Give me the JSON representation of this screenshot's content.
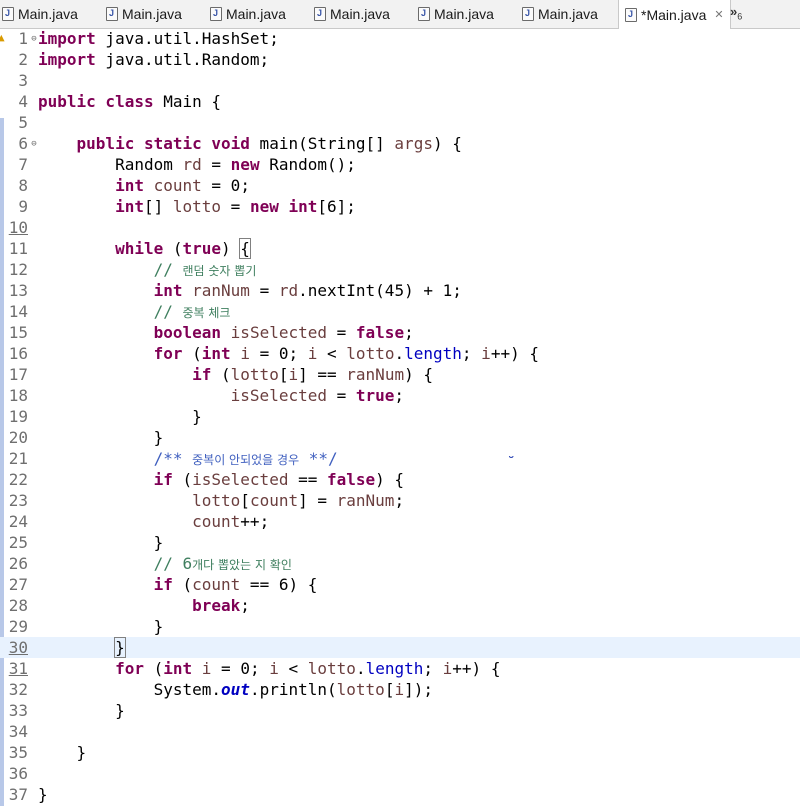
{
  "tabs": [
    {
      "label": "Main.java",
      "active": false
    },
    {
      "label": "Main.java",
      "active": false
    },
    {
      "label": "Main.java",
      "active": false
    },
    {
      "label": "Main.java",
      "active": false
    },
    {
      "label": "Main.java",
      "active": false
    },
    {
      "label": "Main.java",
      "active": false
    },
    {
      "label": "*Main.java",
      "active": true,
      "close": "✕"
    }
  ],
  "overflow": {
    "symbol": "»",
    "count": "6"
  },
  "lines": [
    "1",
    "2",
    "3",
    "4",
    "5",
    "6",
    "7",
    "8",
    "9",
    "10",
    "11",
    "12",
    "13",
    "14",
    "15",
    "16",
    "17",
    "18",
    "19",
    "20",
    "21",
    "22",
    "23",
    "24",
    "25",
    "26",
    "27",
    "28",
    "29",
    "30",
    "31",
    "32",
    "33",
    "34",
    "35",
    "36",
    "37"
  ],
  "code": {
    "l1_kw": "import",
    "l1_rest": " java.util.HashSet;",
    "l2_kw": "import",
    "l2_rest": " java.util.Random;",
    "l4_kw": "public class",
    "l4_rest": " Main {",
    "l6_kw": "public static void",
    "l6_a": " main(String[] ",
    "l6_var": "args",
    "l6_b": ") {",
    "l7_a": "Random ",
    "l7_var": "rd",
    "l7_b": " = ",
    "l7_kw": "new",
    "l7_c": " Random();",
    "l8_kw": "int",
    "l8_sp": " ",
    "l8_var": "count",
    "l8_b": " = 0;",
    "l9_kw": "int",
    "l9_a": "[] ",
    "l9_var": "lotto",
    "l9_b": " = ",
    "l9_kw2": "new",
    "l9_sp": " ",
    "l9_kw3": "int",
    "l9_c": "[6];",
    "l11_kw": "while",
    "l11_a": " (",
    "l11_kw2": "true",
    "l11_b": ") ",
    "l11_brace": "{",
    "l12_cmt": "// ",
    "l12_ko": "랜덤 숫자 뽑기",
    "l13_kw": "int",
    "l13_sp": " ",
    "l13_var": "ranNum",
    "l13_a": " = ",
    "l13_var2": "rd",
    "l13_b": ".nextInt(45) + 1;",
    "l14_cmt": "// ",
    "l14_ko": "중복 체크",
    "l15_kw": "boolean",
    "l15_sp": " ",
    "l15_var": "isSelected",
    "l15_a": " = ",
    "l15_kw2": "false",
    "l15_b": ";",
    "l16_kw": "for",
    "l16_a": " (",
    "l16_kw2": "int",
    "l16_sp": " ",
    "l16_var": "i",
    "l16_b": " = 0; ",
    "l16_var2": "i",
    "l16_c": " < ",
    "l16_var3": "lotto",
    "l16_d": ".",
    "l16_fld": "length",
    "l16_e": "; ",
    "l16_var4": "i",
    "l16_f": "++) {",
    "l17_kw": "if",
    "l17_a": " (",
    "l17_var": "lotto",
    "l17_b": "[",
    "l17_var2": "i",
    "l17_c": "] == ",
    "l17_var3": "ranNum",
    "l17_d": ") {",
    "l18_var": "isSelected",
    "l18_a": " = ",
    "l18_kw": "true",
    "l18_b": ";",
    "l19": "}",
    "l20": "}",
    "l21_jdoc": "/** ",
    "l21_ko": "중복이 안되었을 경우",
    "l21_end": " **/",
    "l22_kw": "if",
    "l22_a": " (",
    "l22_var": "isSelected",
    "l22_b": " == ",
    "l22_kw2": "false",
    "l22_c": ") {",
    "l23_var": "lotto",
    "l23_a": "[",
    "l23_var2": "count",
    "l23_b": "] = ",
    "l23_var3": "ranNum",
    "l23_c": ";",
    "l24_var": "count",
    "l24_a": "++;",
    "l25": "}",
    "l26_cmt": "// 6",
    "l26_ko": "개다 뽑았는 지 확인",
    "l27_kw": "if",
    "l27_a": " (",
    "l27_var": "count",
    "l27_b": " == 6) {",
    "l28_kw": "break",
    "l28_a": ";",
    "l29": "}",
    "l30": "}",
    "l31_kw": "for",
    "l31_a": " (",
    "l31_kw2": "int",
    "l31_sp": " ",
    "l31_var": "i",
    "l31_b": " = 0; ",
    "l31_var2": "i",
    "l31_c": " < ",
    "l31_var3": "lotto",
    "l31_d": ".",
    "l31_fld": "length",
    "l31_e": "; ",
    "l31_var4": "i",
    "l31_f": "++) {",
    "l32_a": "System.",
    "l32_sfld": "out",
    "l32_b": ".println(",
    "l32_var": "lotto",
    "l32_c": "[",
    "l32_var2": "i",
    "l32_d": "]);",
    "l33": "}",
    "l35": "}",
    "l37": "}"
  },
  "colors": {
    "keyword": "#7f0055",
    "local_var": "#6a3e3e",
    "field": "#0000c0",
    "comment": "#3f7f5f",
    "javadoc": "#3f5fbf",
    "current_line": "#e8f2fe"
  }
}
